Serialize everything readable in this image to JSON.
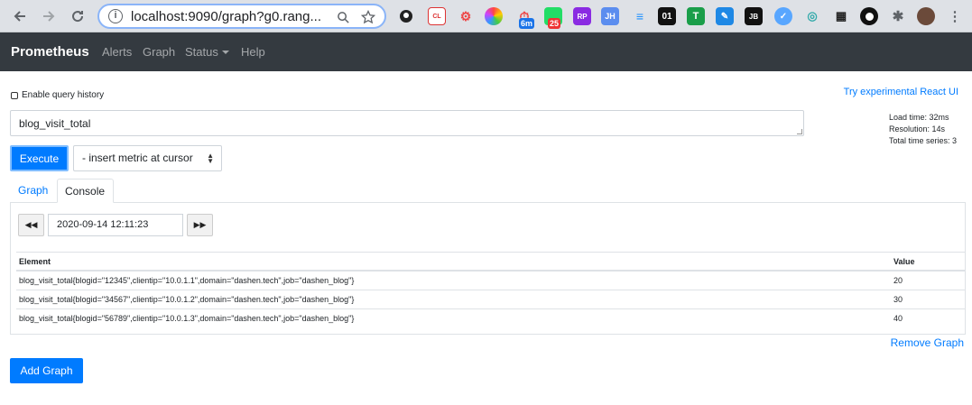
{
  "browser": {
    "url": "localhost:9090/graph?g0.rang...",
    "badges": {
      "timer": "6m",
      "count": "25"
    },
    "ext_labels": {
      "cl": "CL",
      "rp": "RP",
      "jh": "JH",
      "o1": "01",
      "jb": "JB"
    }
  },
  "navbar": {
    "brand": "Prometheus",
    "alerts": "Alerts",
    "graph": "Graph",
    "status": "Status",
    "help": "Help"
  },
  "query": {
    "history_label": "Enable query history",
    "react_link": "Try experimental React UI",
    "expression": "blog_visit_total",
    "stats": {
      "load_time": "Load time: 32ms",
      "resolution": "Resolution: 14s",
      "total_series": "Total time series: 3"
    },
    "execute_label": "Execute",
    "metric_select": "- insert metric at cursor"
  },
  "tabs": {
    "graph": "Graph",
    "console": "Console"
  },
  "console": {
    "eval_time": "2020-09-14 12:11:23",
    "headers": {
      "element": "Element",
      "value": "Value"
    },
    "rows": [
      {
        "element": "blog_visit_total{blogid=\"12345\",clientip=\"10.0.1.1\",domain=\"dashen.tech\",job=\"dashen_blog\"}",
        "value": "20"
      },
      {
        "element": "blog_visit_total{blogid=\"34567\",clientip=\"10.0.1.2\",domain=\"dashen.tech\",job=\"dashen_blog\"}",
        "value": "30"
      },
      {
        "element": "blog_visit_total{blogid=\"56789\",clientip=\"10.0.1.3\",domain=\"dashen.tech\",job=\"dashen_blog\"}",
        "value": "40"
      }
    ]
  },
  "actions": {
    "remove_graph": "Remove Graph",
    "add_graph": "Add Graph"
  },
  "colors": {
    "primary": "#007bff",
    "navbar_bg": "#343a40"
  }
}
